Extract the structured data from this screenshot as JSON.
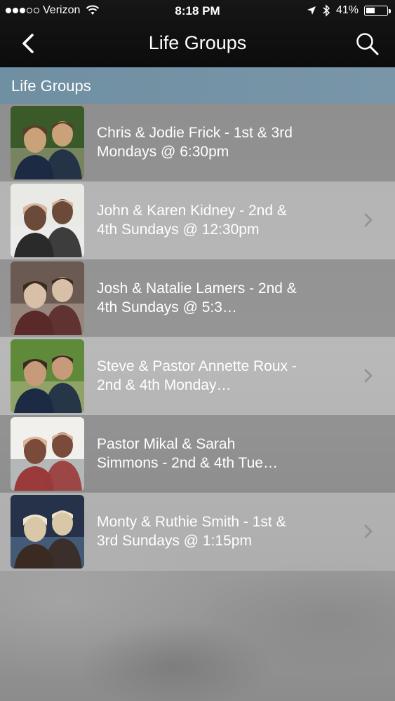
{
  "status_bar": {
    "carrier": "Verizon",
    "time": "8:18 PM",
    "battery_percent": "41%",
    "signal_bars_filled": 3,
    "signal_bars_total": 5
  },
  "navbar": {
    "title": "Life Groups",
    "back_icon": "chevron-left-icon",
    "search_icon": "search-icon"
  },
  "section": {
    "title": "Life Groups"
  },
  "groups": [
    {
      "label": "Chris & Jodie Frick - 1st & 3rd Mondays @ 6:30pm",
      "photo": "couple-photo",
      "shade": "dark",
      "chevron": false
    },
    {
      "label": "John & Karen Kidney - 2nd & 4th Sundays @ 12:30pm",
      "photo": "couple-photo",
      "shade": "light",
      "chevron": true
    },
    {
      "label": "Josh & Natalie Lamers - 2nd & 4th Sundays @ 5:3…",
      "photo": "couple-photo",
      "shade": "dark",
      "chevron": false
    },
    {
      "label": "Steve & Pastor Annette Roux - 2nd & 4th Monday…",
      "photo": "couple-photo",
      "shade": "light",
      "chevron": true
    },
    {
      "label": "Pastor Mikal & Sarah Simmons - 2nd & 4th Tue…",
      "photo": "couple-photo",
      "shade": "dark",
      "chevron": false
    },
    {
      "label": "Monty & Ruthie Smith - 1st & 3rd Sundays @ 1:15pm",
      "photo": "couple-photo",
      "shade": "light",
      "chevron": true
    }
  ],
  "colors": {
    "topbar": "#111111",
    "section_header": "#7393a5",
    "text": "#ffffff"
  }
}
